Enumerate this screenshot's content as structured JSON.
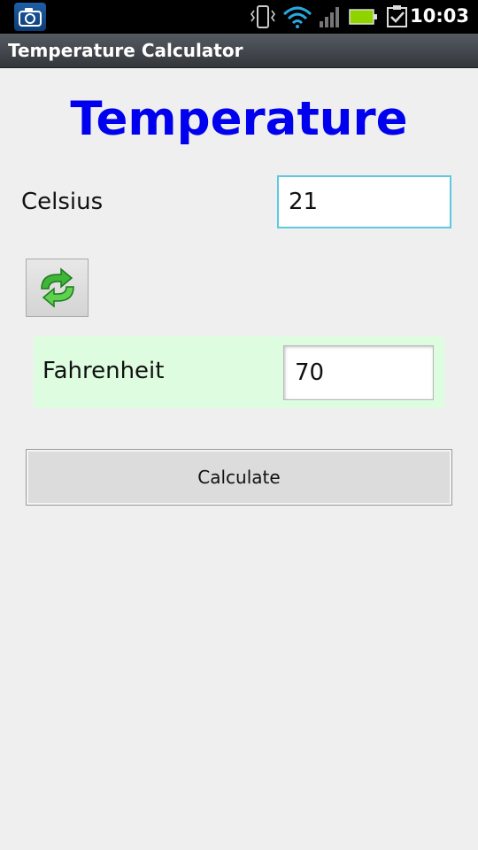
{
  "status_bar": {
    "time": "10:03",
    "icons": [
      "camera-icon",
      "vibrate-icon",
      "wifi-icon",
      "signal-icon",
      "battery-icon",
      "task-check-icon"
    ],
    "battery_color": "#8fd400",
    "wifi_color": "#2aa7e0"
  },
  "app": {
    "title": "Temperature Calculator"
  },
  "main": {
    "heading": "Temperature",
    "heading_color": "#0000ee",
    "celsius": {
      "label": "Celsius",
      "value": "21"
    },
    "swap_icon": "refresh-arrows-icon",
    "fahrenheit": {
      "label": "Fahrenheit",
      "value": "70",
      "panel_color": "#defde0"
    },
    "calculate_label": "Calculate"
  }
}
